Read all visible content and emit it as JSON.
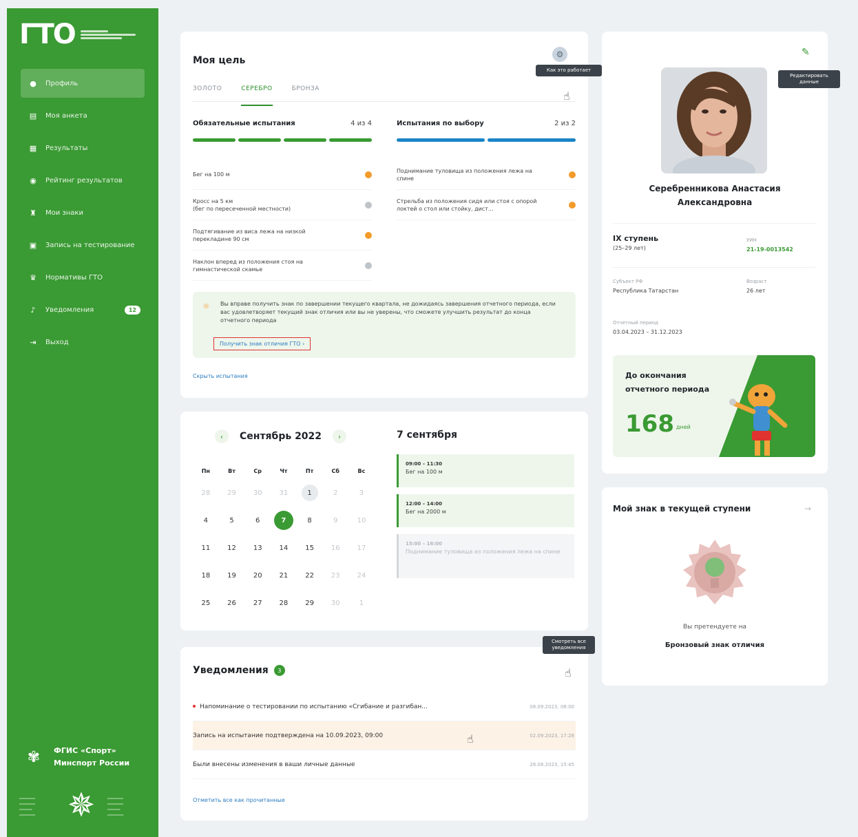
{
  "sidebar": {
    "logo": "ГТО",
    "items": [
      {
        "label": "Профиль",
        "icon": "person-icon"
      },
      {
        "label": "Моя анкета",
        "icon": "document-icon"
      },
      {
        "label": "Результаты",
        "icon": "table-icon"
      },
      {
        "label": "Рейтинг результатов",
        "icon": "rating-icon"
      },
      {
        "label": "Мои знаки",
        "icon": "trophy-icon"
      },
      {
        "label": "Запись на тестирование",
        "icon": "calendar-icon"
      },
      {
        "label": "Нормативы ГТО",
        "icon": "cup-icon"
      },
      {
        "label": "Уведомления",
        "icon": "bell-icon",
        "badge": "12"
      },
      {
        "label": "Выход",
        "icon": "logout-icon"
      }
    ],
    "footer": {
      "line1": "ФГИС «Спорт»",
      "line2": "Минспорт России"
    }
  },
  "goal": {
    "title": "Моя цель",
    "tabs": [
      "ЗОЛОТО",
      "СЕРЕБРО",
      "БРОНЗА"
    ],
    "help_tooltip": "Как это работает",
    "mandatory": {
      "title": "Обязательные испытания",
      "count": "4 из 4",
      "items": [
        {
          "text": "Бег на 100 м",
          "status": "orange"
        },
        {
          "text": "Кросс на 5 км\n(бег по пересеченной местности)",
          "status": "grey"
        },
        {
          "text": "Подтягивание из виса лежа на низкой перекладине 90 см",
          "status": "orange"
        },
        {
          "text": "Наклон вперед из положения стоя на гимнастической скамье",
          "status": "grey"
        }
      ]
    },
    "optional": {
      "title": "Испытания по выбору",
      "count": "2 из 2",
      "items": [
        {
          "text": "Поднимание туловища из положения лежа на спине",
          "status": "orange"
        },
        {
          "text": "Стрельба из положения сидя или стоя с опорой локтей о стол или стойку, дист...",
          "status": "orange"
        }
      ]
    },
    "hint_text": "Вы вправе получить знак по завершении текущего квартала, не дожидаясь завершения отчетного периода, если вас удовлетворяет текущий знак отличия или вы не уверены, что сможете улучшить результат до конца отчетного периода",
    "hint_link": "Получить знак отличия ГТО  ›",
    "hide_link": "Скрыть испытания"
  },
  "calendar": {
    "month": "Сентябрь 2022",
    "dow": [
      "Пн",
      "Вт",
      "Ср",
      "Чт",
      "Пт",
      "Сб",
      "Вс"
    ],
    "days": [
      {
        "d": "28",
        "t": "other"
      },
      {
        "d": "29",
        "t": "other"
      },
      {
        "d": "30",
        "t": "other"
      },
      {
        "d": "31",
        "t": "other"
      },
      {
        "d": "1",
        "t": "today"
      },
      {
        "d": "2",
        "t": "weekend"
      },
      {
        "d": "3",
        "t": "weekend"
      },
      {
        "d": "4",
        "t": ""
      },
      {
        "d": "5",
        "t": ""
      },
      {
        "d": "6",
        "t": ""
      },
      {
        "d": "7",
        "t": "selected"
      },
      {
        "d": "8",
        "t": ""
      },
      {
        "d": "9",
        "t": "weekend"
      },
      {
        "d": "10",
        "t": "weekend"
      },
      {
        "d": "11",
        "t": ""
      },
      {
        "d": "12",
        "t": ""
      },
      {
        "d": "13",
        "t": ""
      },
      {
        "d": "14",
        "t": ""
      },
      {
        "d": "15",
        "t": ""
      },
      {
        "d": "16",
        "t": "weekend"
      },
      {
        "d": "17",
        "t": "weekend"
      },
      {
        "d": "18",
        "t": ""
      },
      {
        "d": "19",
        "t": ""
      },
      {
        "d": "20",
        "t": ""
      },
      {
        "d": "21",
        "t": ""
      },
      {
        "d": "22",
        "t": ""
      },
      {
        "d": "23",
        "t": "weekend"
      },
      {
        "d": "24",
        "t": "weekend"
      },
      {
        "d": "25",
        "t": ""
      },
      {
        "d": "26",
        "t": ""
      },
      {
        "d": "27",
        "t": ""
      },
      {
        "d": "28",
        "t": ""
      },
      {
        "d": "29",
        "t": ""
      },
      {
        "d": "30",
        "t": "weekend"
      },
      {
        "d": "1",
        "t": "other"
      }
    ],
    "selected_title": "7 сентября",
    "events": [
      {
        "time": "09:00 – 11:30",
        "name": "Бег на 100 м",
        "past": false
      },
      {
        "time": "12:00 – 14:00",
        "name": "Бег на 2000 м",
        "past": false
      },
      {
        "time": "15:00 – 16:00",
        "name": "Поднимание туловища из положения лежа на спине",
        "past": true
      }
    ]
  },
  "notifications": {
    "title": "Уведомления",
    "count": "3",
    "tooltip": "Смотреть все уведомления",
    "items": [
      {
        "text": "Напоминание о тестировании по испытанию «Сгибание и разгибан...",
        "date": "08.09.2023, 08:00",
        "unread": true
      },
      {
        "text": "Запись на испытание подтверждена на 10.09.2023, 09:00",
        "date": "02.09.2023, 17:28",
        "unread": false
      },
      {
        "text": "Были внесены изменения в ваши личные данные",
        "date": "28.08.2023, 15:45",
        "unread": false
      }
    ],
    "mark_read": "Отметить все как прочитанные"
  },
  "profile": {
    "edit_tooltip": "Редактировать данные",
    "name": "Серебренникова Анастасия Александровна",
    "stage": "IX ступень",
    "stage_age": "(25–29 лет)",
    "uin_label": "УИН",
    "uin": "21-19-0013542",
    "region_label": "Субъект РФ",
    "region": "Республика Татарстан",
    "age_label": "Возраст",
    "age": "26 лет",
    "period_label": "Отчетный период",
    "period": "03.04.2023 – 31.12.2023",
    "countdown_title": "До окончания отчетного периода",
    "countdown_value": "168",
    "countdown_unit": "дней"
  },
  "badge": {
    "title": "Мой знак в текущей ступени",
    "pretend": "Вы претендуете на",
    "name": "Бронзовый знак отличия"
  },
  "colors": {
    "brand": "#3a9a33",
    "blue": "#1b84c7",
    "orange": "#f39b2b"
  }
}
